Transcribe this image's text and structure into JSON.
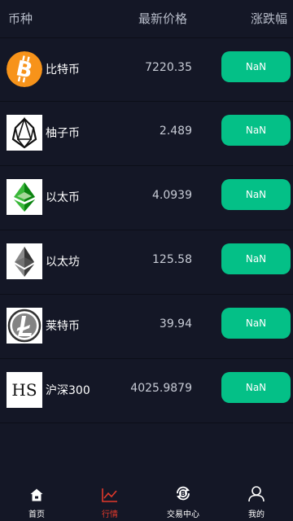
{
  "header": {
    "coin_label": "币种",
    "price_label": "最新价格",
    "change_label": "涨跌幅"
  },
  "coins": [
    {
      "name": "比特币",
      "price": "7220.35",
      "change": "NaN",
      "icon": "bitcoin-icon"
    },
    {
      "name": "柚子币",
      "price": "2.489",
      "change": "NaN",
      "icon": "eos-icon"
    },
    {
      "name": "以太币",
      "price": "4.0939",
      "change": "NaN",
      "icon": "ethereum-classic-icon"
    },
    {
      "name": "以太坊",
      "price": "125.58",
      "change": "NaN",
      "icon": "ethereum-icon"
    },
    {
      "name": "莱特币",
      "price": "39.94",
      "change": "NaN",
      "icon": "litecoin-icon"
    },
    {
      "name": "沪深300",
      "price": "4025.9879",
      "change": "NaN",
      "icon": "hs-logo",
      "logo_text": "HS"
    }
  ],
  "tabs": [
    {
      "label": "首页",
      "icon": "home-icon"
    },
    {
      "label": "行情",
      "icon": "chart-icon",
      "active": true
    },
    {
      "label": "交易中心",
      "icon": "trade-center-icon"
    },
    {
      "label": "我的",
      "icon": "user-icon"
    }
  ],
  "colors": {
    "background": "#141726",
    "accent": "#04c087",
    "active_tab": "#e2392b"
  }
}
